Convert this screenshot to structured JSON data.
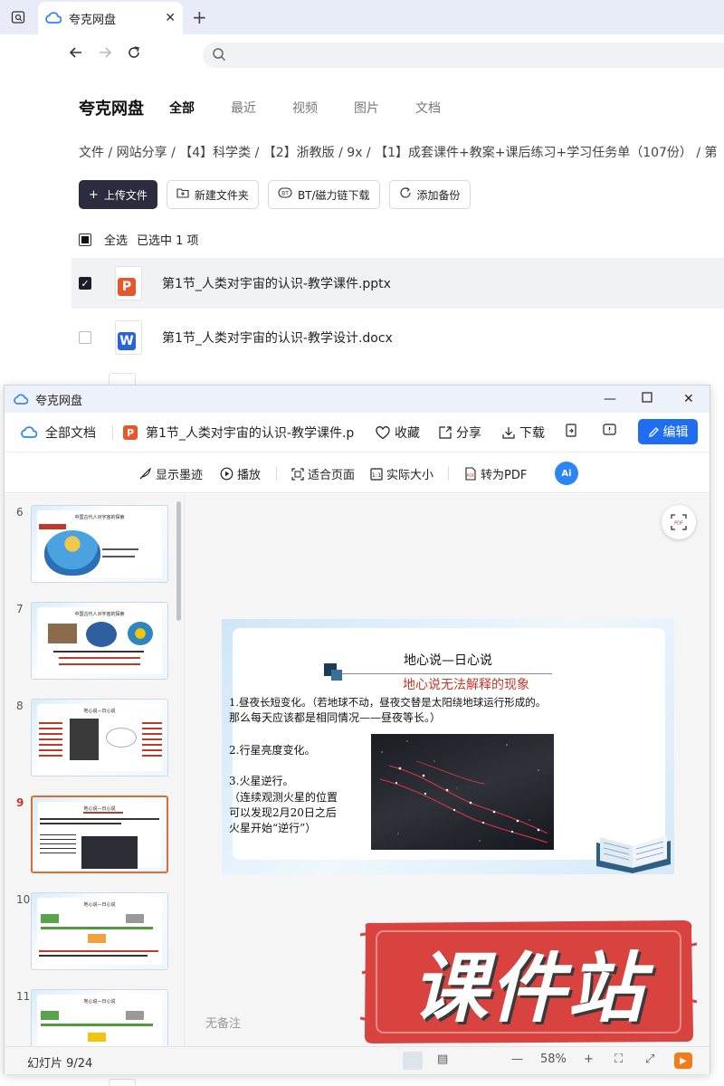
{
  "browser": {
    "tab_title": "夸克网盘",
    "tab_close": "✕",
    "new_tab": "+"
  },
  "page": {
    "brand": "夸克网盘",
    "tabs": [
      "全部",
      "最近",
      "视频",
      "图片",
      "文档"
    ],
    "active_tab": "全部",
    "breadcrumb": "文件 / 网站分享 / 【4】科学类 / 【2】浙教版 / 9x / 【1】成套课件+教案+课后练习+学习任务单（107份） / 第",
    "actions": [
      "上传文件",
      "新建文件夹",
      "BT/磁力链下载",
      "添加备份"
    ],
    "select_all": "全选",
    "selected_info": "已选中  1  项",
    "files": [
      {
        "name": "第1节_人类对宇宙的认识-教学课件.pptx",
        "type": "P",
        "color": "#e8572c",
        "selected": true
      },
      {
        "name": "第1节_人类对宇宙的认识-教学设计.docx",
        "type": "W",
        "color": "#2b63d9",
        "selected": false
      }
    ]
  },
  "viewer": {
    "title": "夸克网盘",
    "all_docs": "全部文档",
    "doc_name": "第1节_人类对宇宙的认识-教学课件.p",
    "favorite": "收藏",
    "share": "分享",
    "download": "下载",
    "edit": "编辑",
    "show_ink": "显示墨迹",
    "play": "播放",
    "fit_page": "适合页面",
    "actual_size": "实际大小",
    "to_pdf": "转为PDF",
    "ai": "Ai",
    "thumb_numbers": [
      "6",
      "7",
      "8",
      "9",
      "10",
      "11"
    ],
    "active_thumb": "9",
    "thumb_titles": [
      "中国古代人对宇宙的探索",
      "中国古代人对宇宙的探索",
      "地心说—日心说",
      "地心说—日心说",
      "地心说—日心说",
      "地心说—日心说"
    ],
    "no_notes": "无备注",
    "slide_counter": "幻灯片 9/24",
    "zoom": "58%"
  },
  "slide": {
    "title": "地心说—日心说",
    "subtitle": "地心说无法解释的现象",
    "line1": "1.昼夜长短变化。（若地球不动，昼夜交替是太阳绕地球运行形成的。",
    "line2": "那么每天应该都是相同情况——昼夜等长。）",
    "line3": "2.行星亮度变化。",
    "line4": "3.火星逆行。",
    "line5": "（连续观测火星的位置",
    "line6": "可以发现2月20日之后",
    "line7": "火星开始“逆行”）"
  },
  "watermark": {
    "text": "课件站",
    "color": "#d8423f"
  }
}
